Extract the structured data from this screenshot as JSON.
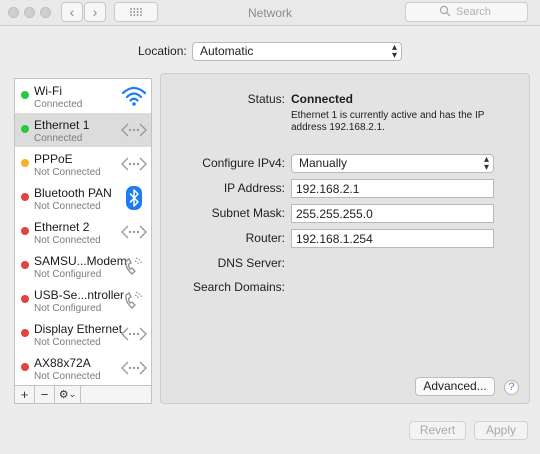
{
  "window": {
    "title": "Network",
    "search_placeholder": "Search"
  },
  "toolbar": {
    "back_glyph": "‹",
    "forward_glyph": "›",
    "show_all_glyph": "⠿"
  },
  "location": {
    "label": "Location:",
    "value": "Automatic"
  },
  "services": [
    {
      "name": "Wi-Fi",
      "status": "Connected",
      "status_color": "#28c840",
      "icon": "wifi-icon"
    },
    {
      "name": "Ethernet 1",
      "status": "Connected",
      "status_color": "#28c840",
      "icon": "ethernet-icon"
    },
    {
      "name": "PPPoE",
      "status": "Not Connected",
      "status_color": "#f3b12a",
      "icon": "ethernet-icon"
    },
    {
      "name": "Bluetooth PAN",
      "status": "Not Connected",
      "status_color": "#e2443c",
      "icon": "bluetooth-icon"
    },
    {
      "name": "Ethernet 2",
      "status": "Not Connected",
      "status_color": "#e2443c",
      "icon": "ethernet-icon"
    },
    {
      "name": "SAMSU...Modem",
      "status": "Not Configured",
      "status_color": "#e2443c",
      "icon": "phone-icon"
    },
    {
      "name": "USB-Se...ntroller",
      "status": "Not Configured",
      "status_color": "#e2443c",
      "icon": "phone-icon"
    },
    {
      "name": "Display Ethernet",
      "status": "Not Connected",
      "status_color": "#e2443c",
      "icon": "ethernet-icon"
    },
    {
      "name": "AX88x72A",
      "status": "Not Connected",
      "status_color": "#e2443c",
      "icon": "ethernet-icon"
    }
  ],
  "selected_service": "Ethernet 1",
  "sidebar_actions": {
    "add": "+",
    "remove": "−",
    "gear": "⚙︎",
    "gear_chevron": "⌄"
  },
  "detail": {
    "status_label": "Status:",
    "status_value": "Connected",
    "status_desc_line1": "Ethernet 1 is currently active and has the IP",
    "status_desc_line2": "address 192.168.2.1.",
    "configure_label": "Configure IPv4:",
    "configure_value": "Manually",
    "ip_label": "IP Address:",
    "ip_value": "192.168.2.1",
    "subnet_label": "Subnet Mask:",
    "subnet_value": "255.255.255.0",
    "router_label": "Router:",
    "router_value": "192.168.1.254",
    "dns_label": "DNS Server:",
    "search_domains_label": "Search Domains:",
    "advanced_label": "Advanced...",
    "help_glyph": "?"
  },
  "footer": {
    "revert_label": "Revert",
    "apply_label": "Apply"
  },
  "colors": {
    "connected": "#28c840",
    "pending": "#f3b12a",
    "disconnected": "#e2443c",
    "accent": "#1e7cf2"
  }
}
